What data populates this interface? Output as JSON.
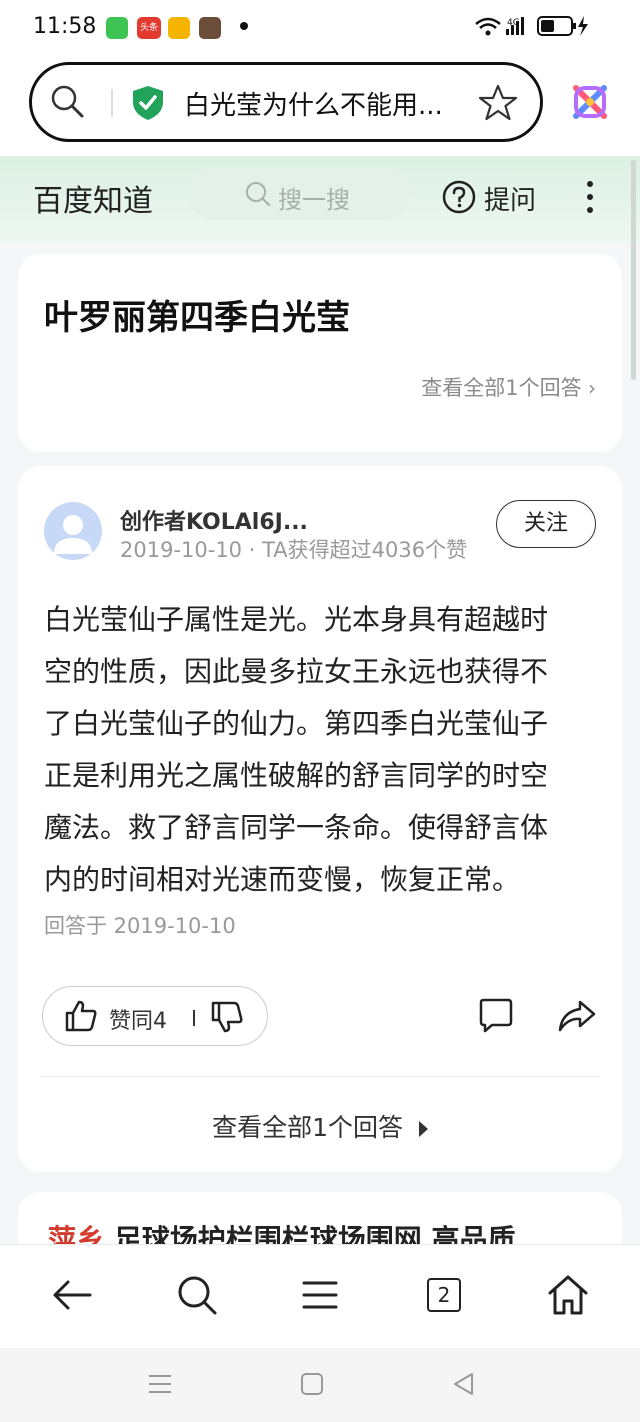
{
  "status_bar": {
    "time": "11:58",
    "app_icons": [
      "app-store-icon",
      "toutiao-icon",
      "weibo-icon",
      "game-icon"
    ],
    "network": "4G",
    "badge_text": "头条"
  },
  "url_bar": {
    "title": "白光莹为什么不能用...",
    "secure_color": "#22a35a"
  },
  "header": {
    "brand": "百度知道",
    "search_placeholder": "搜一搜",
    "ask_label": "提问"
  },
  "question": {
    "title": "叶罗丽第四季白光莹",
    "view_all": "查看全部1个回答"
  },
  "answer": {
    "author": "创作者KOLAl6J...",
    "meta": "2019-10-10 · TA获得超过4036个赞",
    "follow_label": "关注",
    "lines": [
      "白光莹仙子属性是光。光本身具有超越时",
      "空的性质，因此曼多拉女王永远也获得不",
      "了白光莹仙子的仙力。第四季白光莹仙子",
      "正是利用光之属性破解的舒言同学的时空",
      "魔法。救了舒言同学一条命。使得舒言体",
      "内的时间相对光速而变慢，恢复正常。"
    ],
    "answered_at": "回答于 2019-10-10",
    "like_label": "赞同4",
    "view_all": "查看全部1个回答"
  },
  "ad": {
    "prefix": "萍乡",
    "text": "足球场护栏围栏球场围网 高品质"
  },
  "bottom_nav": {
    "tab_count": "2"
  }
}
